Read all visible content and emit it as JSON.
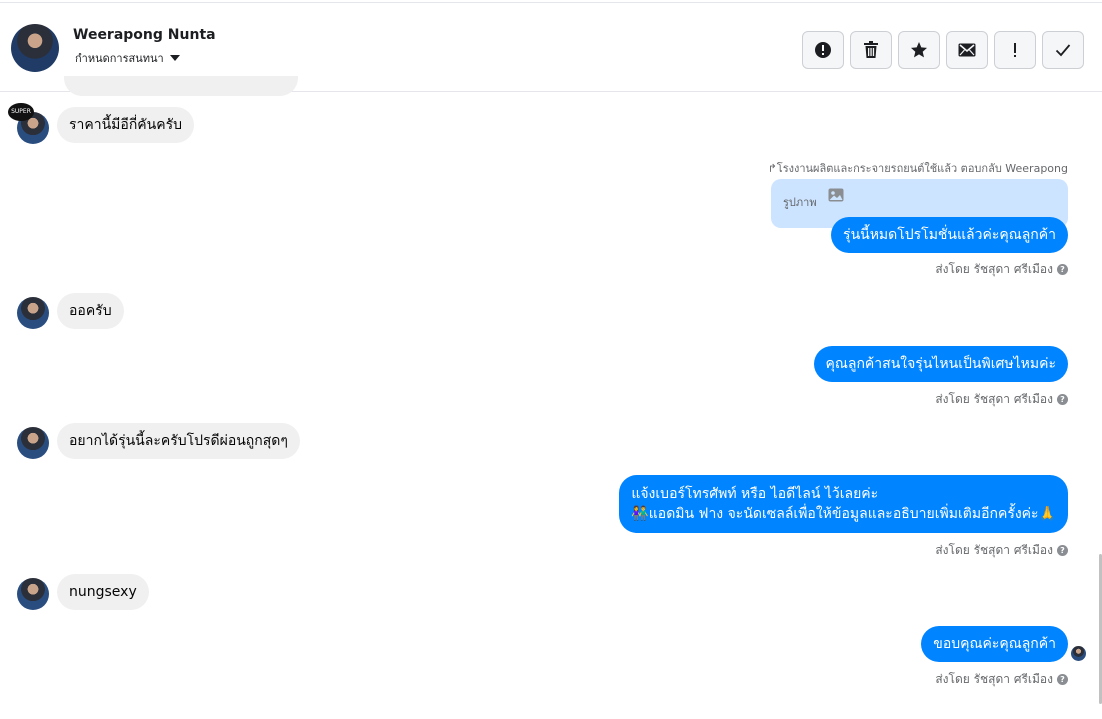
{
  "header": {
    "contact_name": "Weerapong Nunta",
    "assign_label": "กำหนดการสนทนา",
    "toolbar": [
      {
        "name": "report-button",
        "icon": "alert-circle-icon"
      },
      {
        "name": "delete-button",
        "icon": "trash-icon"
      },
      {
        "name": "star-button",
        "icon": "star-icon"
      },
      {
        "name": "mark-unread-button",
        "icon": "envelope-icon"
      },
      {
        "name": "important-button",
        "icon": "exclamation-icon"
      },
      {
        "name": "mark-done-button",
        "icon": "check-icon"
      }
    ]
  },
  "page_badge": "SUPER",
  "messages": {
    "m1": "ราคานี้มีอีกี่คันครับ",
    "reply_note": "↱โรงงานผลิตและกระจายรถยนต์ใช้แล้ว ตอบกลับ Weerapong",
    "quote_text": "รูปภาพ",
    "m2": "รุ่นนี้หมดโปรโมชั่นแล้วค่ะคุณลูกค้า",
    "sent_by": "ส่งโดย รัชสุดา ศรีเมือง",
    "m3": "ออครับ",
    "m4": "คุณลูกค้าสนใจรุ่นไหนเป็นพิเศษไหมค่ะ",
    "m5": "อยากได้รุ่นนี้ละครับโปรดีผ่อนถูกสุดๆ",
    "m6_line1": "แจ้งเบอร์โทรศัพท์ หรือ ไอดีไลน์  ไว้เลยค่ะ",
    "m6_line2": "👫แอดมิน ฟาง จะนัดเซลล์เพื่อให้ข้อมูลและอธิบายเพิ่มเติมอีกครั้งค่ะ🙏",
    "m7": "nungsexy",
    "m8": "ขอบคุณค่ะคุณลูกค้า"
  },
  "colors": {
    "outgoing_bubble": "#0084ff",
    "incoming_bubble": "#f0f0f0",
    "quote_bg": "#cce4ff"
  }
}
